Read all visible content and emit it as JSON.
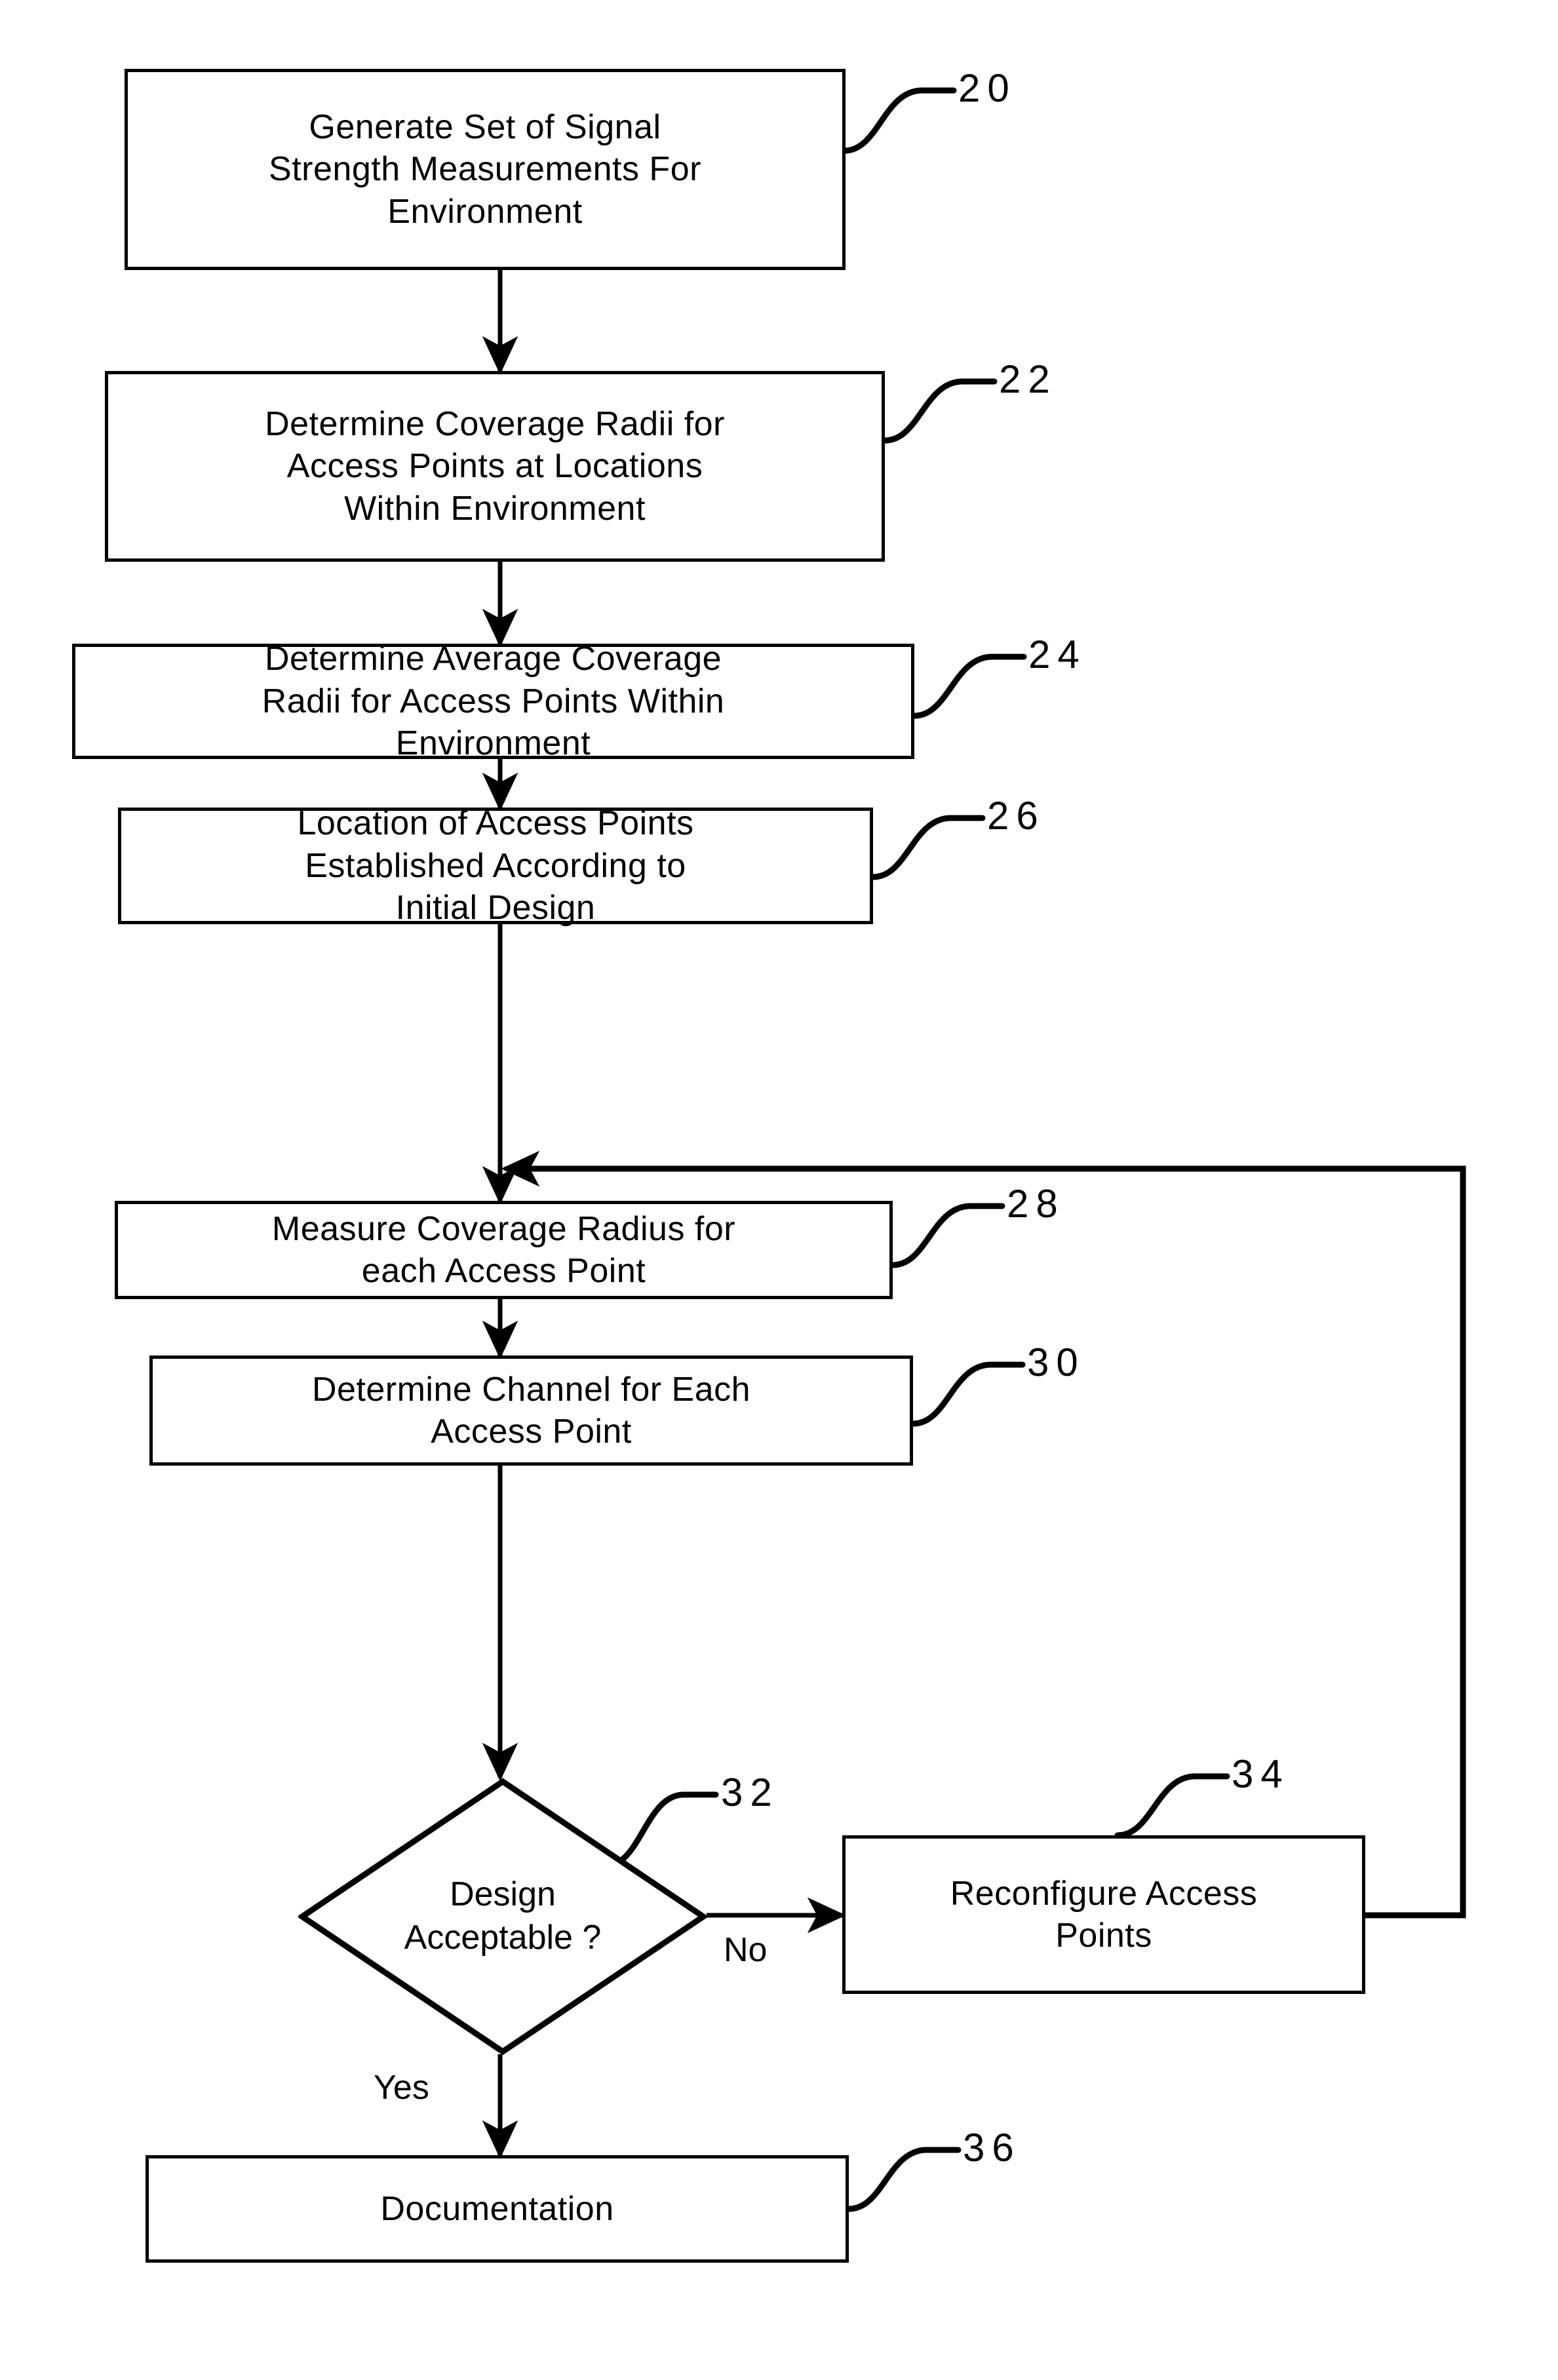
{
  "figure": {
    "type": "process-flowchart",
    "title": "Wireless Access Point Design Process Flowchart"
  },
  "nodes": [
    {
      "id": "n20",
      "shape": "rectangle",
      "text": "Generate Set of Signal\nStrength Measurements For\nEnvironment",
      "ref": "20"
    },
    {
      "id": "n22",
      "shape": "rectangle",
      "text": "Determine Coverage Radii for\nAccess Points at Locations\nWithin Environment",
      "ref": "22"
    },
    {
      "id": "n24",
      "shape": "rectangle",
      "text": "Determine Average Coverage\nRadii for Access Points Within\nEnvironment",
      "ref": "24"
    },
    {
      "id": "n26",
      "shape": "rectangle",
      "text": "Location of Access Points\nEstablished According to\nInitial Design",
      "ref": "26"
    },
    {
      "id": "n28",
      "shape": "rectangle",
      "text": "Measure Coverage Radius for\neach Access Point",
      "ref": "28"
    },
    {
      "id": "n30",
      "shape": "rectangle",
      "text": "Determine Channel for Each\nAccess Point",
      "ref": "30"
    },
    {
      "id": "n32",
      "shape": "diamond",
      "text": "Design\nAcceptable ?",
      "ref": "32"
    },
    {
      "id": "n34",
      "shape": "rectangle",
      "text": "Reconfigure Access\nPoints",
      "ref": "34"
    },
    {
      "id": "n36",
      "shape": "rectangle",
      "text": "Documentation",
      "ref": "36"
    }
  ],
  "edge_labels": {
    "no": "No",
    "yes": "Yes"
  },
  "colors": {
    "stroke": "#000000",
    "fill": "#ffffff",
    "text": "#000000"
  }
}
